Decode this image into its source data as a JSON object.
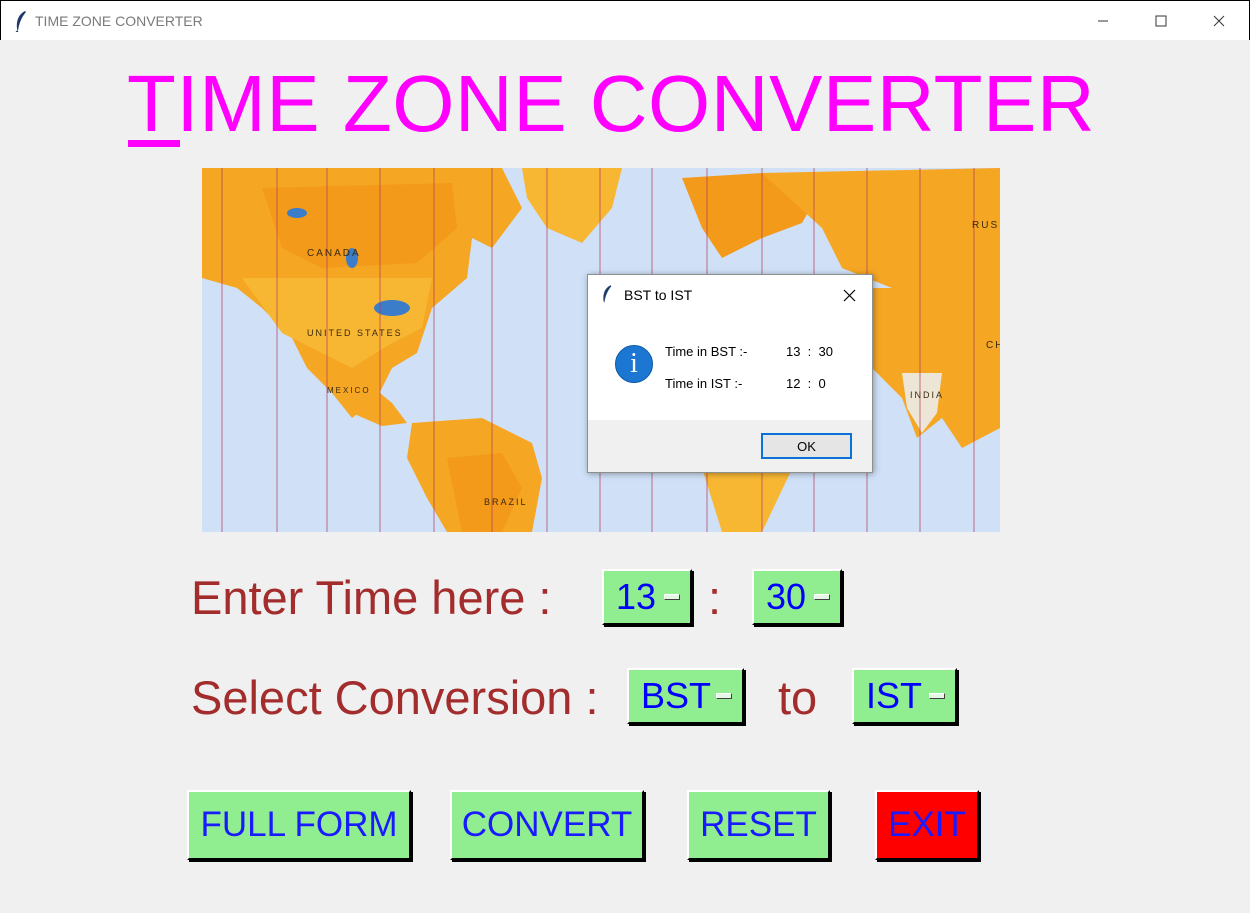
{
  "window": {
    "title": "TIME ZONE CONVERTER",
    "controls": [
      "minimize",
      "maximize",
      "close"
    ]
  },
  "heading": "TIME ZONE CONVERTER",
  "map_image": {
    "description_labels": [
      "CANADA",
      "UNITED STATES",
      "MEXICO",
      "BRAZIL",
      "INDIA",
      "RUS",
      "CH"
    ]
  },
  "form": {
    "enter_time_label": "Enter Time here :",
    "separator": ":",
    "hour": "13",
    "minute": "30",
    "conversion_label": "Select Conversion :",
    "from_zone": "BST",
    "to_word": "to",
    "to_zone": "IST"
  },
  "buttons": {
    "full_form": "FULL FORM",
    "convert": "CONVERT",
    "reset": "RESET",
    "exit": "EXIT"
  },
  "dialog": {
    "title": "BST to IST",
    "line1_label": "Time in BST :-",
    "line1_value": "13  :  30",
    "line2_label": "Time in IST :-",
    "line2_value": "12  :  0",
    "ok_label": "OK"
  },
  "colors": {
    "heading": "#ff00ff",
    "label": "#a32c2c",
    "button_bg": "#90ee90",
    "button_text": "#0000ff",
    "exit_bg": "#ff0000",
    "info_icon": "#1b77d2"
  }
}
